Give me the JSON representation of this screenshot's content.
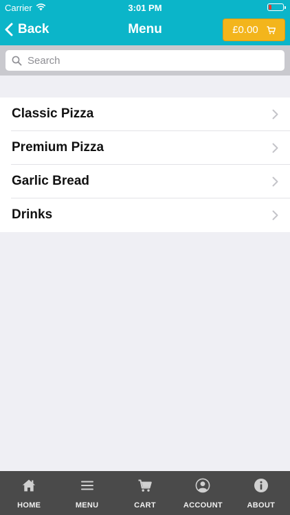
{
  "status_bar": {
    "carrier": "Carrier",
    "time": "3:01 PM"
  },
  "nav": {
    "back_label": "Back",
    "title": "Menu",
    "cart_total": "£0.00"
  },
  "search": {
    "placeholder": "Search"
  },
  "menu": {
    "items": [
      {
        "label": "Classic Pizza"
      },
      {
        "label": "Premium Pizza"
      },
      {
        "label": "Garlic Bread"
      },
      {
        "label": "Drinks"
      }
    ]
  },
  "tabs": [
    {
      "label": "HOME",
      "icon": "home-icon"
    },
    {
      "label": "MENU",
      "icon": "menu-icon"
    },
    {
      "label": "CART",
      "icon": "cart-icon"
    },
    {
      "label": "ACCOUNT",
      "icon": "account-icon"
    },
    {
      "label": "ABOUT",
      "icon": "info-icon"
    }
  ],
  "colors": {
    "header": "#0bb5c9",
    "cart_button": "#f3b51c",
    "tab_bar": "#4a4a4a",
    "background": "#efeff4"
  }
}
